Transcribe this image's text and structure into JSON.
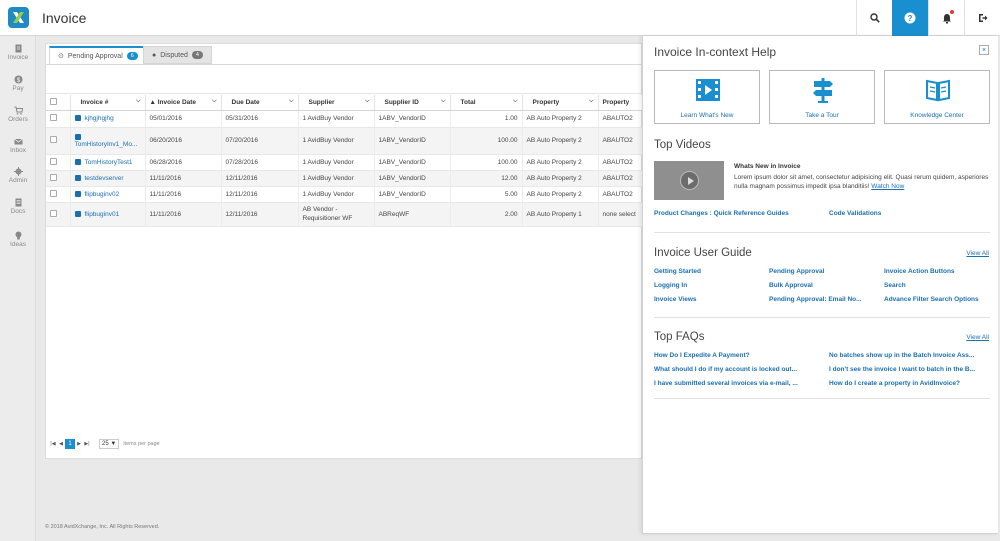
{
  "app": {
    "title": "Invoice",
    "accent_color": "#1a8fd0"
  },
  "topbar": {
    "icons": [
      "search-icon",
      "help-icon",
      "bell-icon",
      "logout-icon"
    ]
  },
  "sidebar": {
    "items": [
      {
        "label": "Invoice",
        "icon": "invoice-icon"
      },
      {
        "label": "Pay",
        "icon": "pay-icon"
      },
      {
        "label": "Orders",
        "icon": "cart-icon"
      },
      {
        "label": "Inbox",
        "icon": "inbox-icon"
      },
      {
        "label": "Admin",
        "icon": "gear-icon"
      },
      {
        "label": "Docs",
        "icon": "docs-icon"
      },
      {
        "label": "Ideas",
        "icon": "lightbulb-icon"
      }
    ]
  },
  "tabs": [
    {
      "label": "Pending Approval",
      "count": "6"
    },
    {
      "label": "Disputed",
      "count": "4"
    }
  ],
  "grid": {
    "columns": [
      "Invoice #",
      "Invoice Date",
      "Due Date",
      "Supplier",
      "Supplier ID",
      "Total",
      "Property",
      "Property"
    ],
    "sort_indicator": "▲",
    "rows": [
      {
        "invoice": "kjhgjhgjhg",
        "invoice_date": "05/01/2016",
        "due_date": "05/31/2016",
        "supplier": "1 AvidBuy Vendor",
        "supplier_id": "1ABV_VendorID",
        "total": "1.00",
        "property": "AB Auto Property 2",
        "property_code": "ABAUTO2"
      },
      {
        "invoice": "TomHistoryInv1_Mo...",
        "invoice_date": "06/20/2016",
        "due_date": "07/20/2016",
        "supplier": "1 AvidBuy Vendor",
        "supplier_id": "1ABV_VendorID",
        "total": "100.00",
        "property": "AB Auto Property 2",
        "property_code": "ABAUTO2"
      },
      {
        "invoice": "TomHistoryTest1",
        "invoice_date": "06/28/2016",
        "due_date": "07/28/2016",
        "supplier": "1 AvidBuy Vendor",
        "supplier_id": "1ABV_VendorID",
        "total": "100.00",
        "property": "AB Auto Property 2",
        "property_code": "ABAUTO2"
      },
      {
        "invoice": "testdevserver",
        "invoice_date": "11/11/2016",
        "due_date": "12/11/2016",
        "supplier": "1 AvidBuy Vendor",
        "supplier_id": "1ABV_VendorID",
        "total": "12.00",
        "property": "AB Auto Property 2",
        "property_code": "ABAUTO2"
      },
      {
        "invoice": "flipbuginv02",
        "invoice_date": "11/11/2016",
        "due_date": "12/11/2016",
        "supplier": "1 AvidBuy Vendor",
        "supplier_id": "1ABV_VendorID",
        "total": "5.00",
        "property": "AB Auto Property 2",
        "property_code": "ABAUTO2"
      },
      {
        "invoice": "flipbuginv01",
        "invoice_date": "11/11/2016",
        "due_date": "12/11/2016",
        "supplier": "AB Vendor - Requisitioner WF",
        "supplier_id": "ABReqWF",
        "total": "2.00",
        "property": "AB Auto Property 1",
        "property_code": "none select"
      }
    ]
  },
  "pager": {
    "current_page": "1",
    "page_size": "25",
    "page_size_label": "items per page"
  },
  "footer": {
    "copyright": "© 2018 AvidXchange, Inc. All Rights Reserved."
  },
  "help": {
    "title": "Invoice In-context Help",
    "close_label": "×",
    "cards": [
      {
        "label": "Learn What's New",
        "icon": "film-icon"
      },
      {
        "label": "Take a Tour",
        "icon": "signpost-icon"
      },
      {
        "label": "Knowledge Center",
        "icon": "book-icon"
      }
    ],
    "top_videos": {
      "title": "Top Videos",
      "video_title": "Whats New in Invoice",
      "video_desc": "Lorem ipsum dolor sit amet, consectetur adipisicing elit. Quasi rerum quidem, asperiores nulla magnam possimus impedit ipsa blanditiis!",
      "watch_now": "Watch Now",
      "links": [
        "Product Changes : Quick Reference Guides",
        "Code Validations"
      ]
    },
    "user_guide": {
      "title": "Invoice User Guide",
      "view_all": "View All",
      "links": [
        "Getting Started",
        "Pending Approval",
        "Invoice Action Buttons",
        "Logging In",
        "Bulk Approval",
        "Search",
        "Invoice Views",
        "Pending Approval: Email No...",
        "Advance Filter Search Options"
      ]
    },
    "faqs": {
      "title": "Top FAQs",
      "view_all": "View All",
      "links": [
        "How Do I Expedite A Payment?",
        "No batches show up in the Batch Invoice Ass...",
        "What should I do if my account is locked out...",
        "I don't see the invoice I want to batch in the B...",
        "I have submitted several invoices via e-mail, ...",
        "How do I create a property in AvidInvoice?"
      ]
    }
  }
}
